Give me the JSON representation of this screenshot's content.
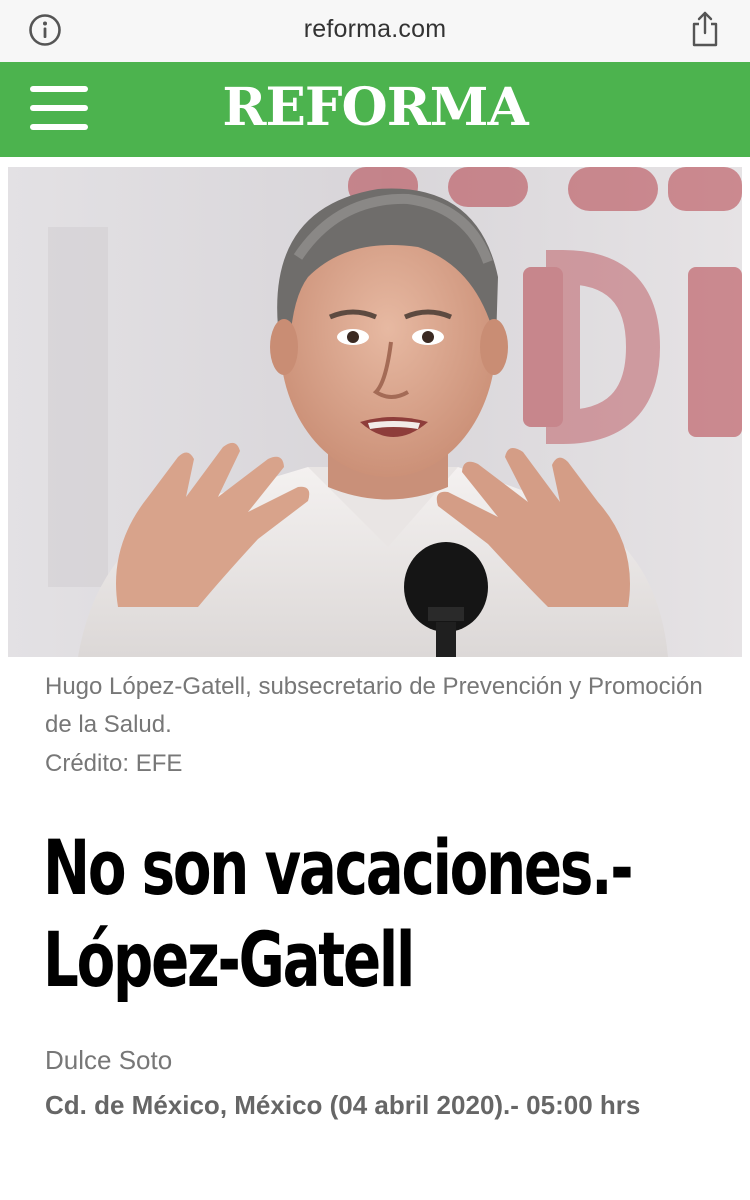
{
  "browser": {
    "url": "reforma.com",
    "info_icon": "info-circle-icon",
    "share_icon": "share-icon"
  },
  "header": {
    "menu_icon": "hamburger-menu-icon",
    "brand": "REFORMA",
    "background_color": "#4cb34e"
  },
  "article": {
    "photo_description_icon": "news-photo",
    "caption": "Hugo López-Gatell, subsecretario de Prevención y Promoción de la Salud.",
    "credit": "Crédito: EFE",
    "headline": "No son vacaciones.- López-Gatell",
    "author": "Dulce Soto",
    "dateline": "Cd. de México, México (04 abril 2020).- 05:00 hrs"
  }
}
